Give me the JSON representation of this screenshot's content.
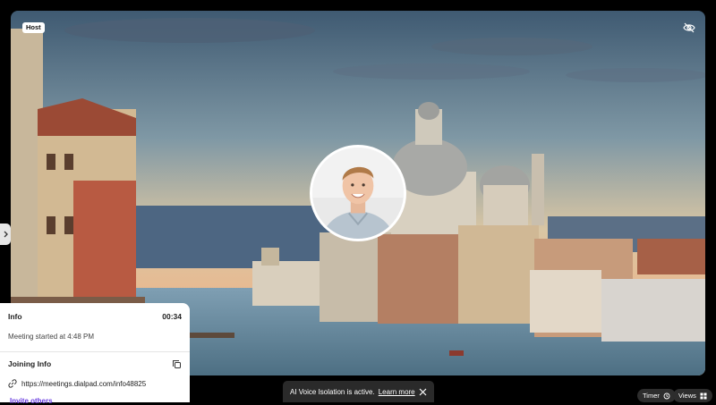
{
  "video": {
    "host_badge": "Host",
    "participant_icon": "avatar-photo"
  },
  "info_panel": {
    "title": "Info",
    "timer": "00:34",
    "meeting_started": "Meeting started at 4:48 PM",
    "joining_title": "Joining Info",
    "meeting_link": "https://meetings.dialpad.com/info48825",
    "invite_label": "Invite others"
  },
  "toast": {
    "message": "AI Voice Isolation is active.",
    "link": "Learn more"
  },
  "controls": {
    "timer_label": "Timer",
    "views_label": "Views"
  },
  "colors": {
    "accent": "#6b3fe0",
    "toast_bg": "#2a2a2a"
  }
}
